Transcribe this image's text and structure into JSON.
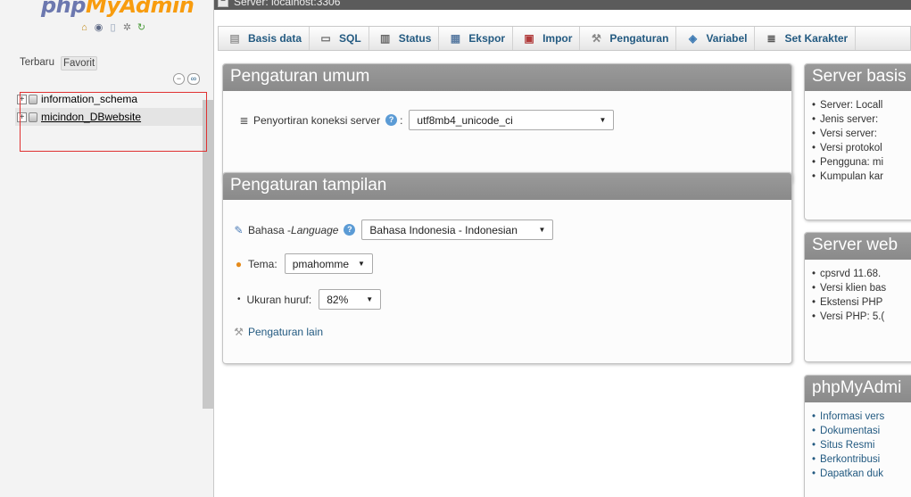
{
  "nav": {
    "logo_php": "php",
    "logo_myadmin": "MyAdmin",
    "icons": [
      "home-icon",
      "logout-icon",
      "query-window-icon",
      "settings-icon",
      "reload-icon"
    ],
    "tabs": {
      "recent": "Terbaru",
      "favorite": "Favorit"
    },
    "databases": [
      {
        "name": "information_schema"
      },
      {
        "name": "micindon_DBwebsite"
      }
    ],
    "expander_symbol": "+"
  },
  "topbar": {
    "breadcrumb": "Server: localhost:3306"
  },
  "menu": {
    "tabs": [
      {
        "label": "Basis data",
        "icon": "database-icon"
      },
      {
        "label": "SQL",
        "icon": "sql-icon"
      },
      {
        "label": "Status",
        "icon": "status-icon"
      },
      {
        "label": "Ekspor",
        "icon": "export-icon"
      },
      {
        "label": "Impor",
        "icon": "import-icon"
      },
      {
        "label": "Pengaturan",
        "icon": "wrench-icon"
      },
      {
        "label": "Variabel",
        "icon": "variables-icon"
      },
      {
        "label": "Set Karakter",
        "icon": "charset-icon"
      }
    ]
  },
  "general": {
    "title": "Pengaturan umum",
    "collation_label": "Penyortiran koneksi server",
    "collation_colon": ":",
    "collation_value": "utf8mb4_unicode_ci"
  },
  "appearance": {
    "title": "Pengaturan tampilan",
    "language_label": "Bahasa - ",
    "language_label_italic": "Language",
    "language_value": "Bahasa Indonesia - Indonesian",
    "theme_label": "Tema:",
    "theme_value": "pmahomme",
    "fontsize_label": "Ukuran huruf:",
    "fontsize_value": "82%",
    "more_settings": "Pengaturan lain"
  },
  "server_panel": {
    "title": "Server basis",
    "items": [
      "Server: Locall",
      "Jenis server: ",
      "Versi server: ",
      "Versi protokol",
      "Pengguna: mi",
      "Kumpulan kar"
    ]
  },
  "webserver_panel": {
    "title": "Server web",
    "items": [
      "cpsrvd 11.68.",
      "Versi klien bas",
      "Ekstensi PHP",
      "Versi PHP: 5.("
    ]
  },
  "pma_panel": {
    "title": "phpMyAdmi",
    "items": [
      "Informasi vers",
      "Dokumentasi",
      "Situs Resmi",
      "Berkontribusi",
      "Dapatkan duk"
    ]
  },
  "colors": {
    "accent_link": "#235a81",
    "logo_php": "#6c78af",
    "logo_myadmin": "#f89c0e",
    "panel_header": "#8f8f8f",
    "annotation_box": "#e03131"
  }
}
